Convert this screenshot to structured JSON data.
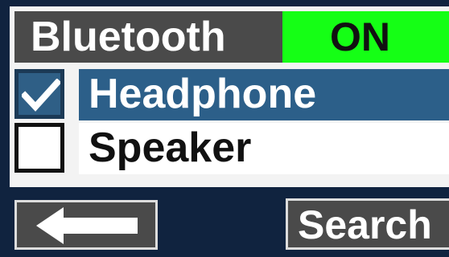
{
  "header": {
    "title": "Bluetooth",
    "toggle_state": "ON",
    "toggle_color": "#15ff15"
  },
  "devices": [
    {
      "label": "Headphone",
      "checked": true,
      "selected": true
    },
    {
      "label": "Speaker",
      "checked": false,
      "selected": false
    }
  ],
  "footer": {
    "back_icon": "left-arrow-icon",
    "search_label": "Search"
  },
  "colors": {
    "background": "#10233f",
    "header_bg": "#4a4a4a",
    "selected_row": "#2c5f89",
    "checkbox_checked": "#2f5f86"
  }
}
